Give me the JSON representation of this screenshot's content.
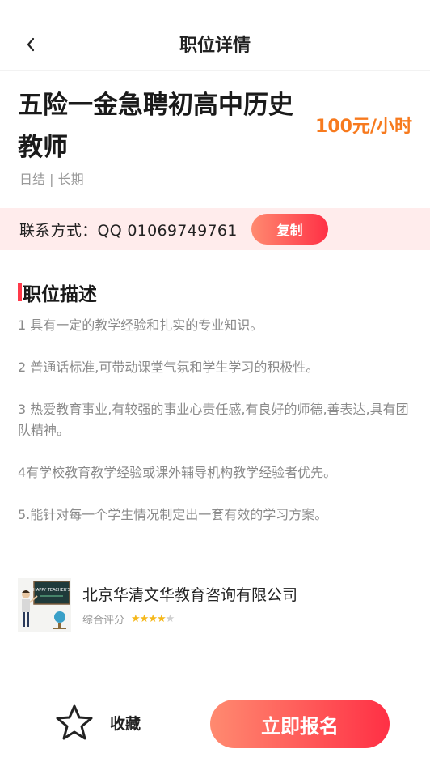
{
  "header": {
    "title": "职位详情",
    "back_icon": "chevron-left-icon"
  },
  "job": {
    "title": "五险一金急聘初高中历史教师",
    "salary": "100元/小时",
    "tags": "日结 | 长期"
  },
  "contact": {
    "text": "联系方式：QQ 01069749761",
    "copy_label": "复制"
  },
  "description": {
    "heading": "职位描述",
    "items": [
      "1 具有一定的教学经验和扎实的专业知识。",
      "2 普通话标准,可带动课堂气氛和学生学习的积极性。",
      "3 热爱教育事业,有较强的事业心责任感,有良好的师德,善表达,具有团队精神。",
      "4有学校教育教学经验或课外辅导机构教学经验者优先。",
      "5.能针对每一个学生情况制定出一套有效的学习方案。"
    ]
  },
  "company": {
    "name": "北京华清文华教育咨询有限公司",
    "rating_label": "综合评分",
    "rating": 4,
    "rating_max": 5,
    "logo_text": "HAPPY TEACHER'S"
  },
  "footer": {
    "favorite_label": "收藏",
    "apply_label": "立即报名"
  },
  "colors": {
    "accent": "#ff3045",
    "accent_start": "#ff8a70",
    "salary": "#f77a1e",
    "band": "#ffecec",
    "star": "#f5b81b"
  }
}
